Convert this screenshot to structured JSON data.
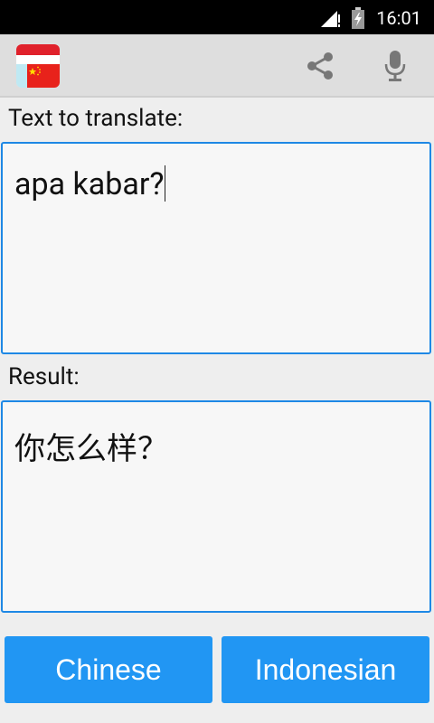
{
  "status_bar": {
    "time": "16:01"
  },
  "action_bar": {
    "share_icon": "share-icon",
    "mic_icon": "microphone-icon",
    "app_icon": "indonesia-china-flag-icon"
  },
  "input_section": {
    "label": "Text to translate:",
    "value": "apa kabar?"
  },
  "result_section": {
    "label": "Result:",
    "value": "你怎么样？"
  },
  "buttons": {
    "source_language": "Chinese",
    "target_language": "Indonesian"
  },
  "colors": {
    "accent": "#2196f3",
    "field_border": "#1e88e5"
  }
}
